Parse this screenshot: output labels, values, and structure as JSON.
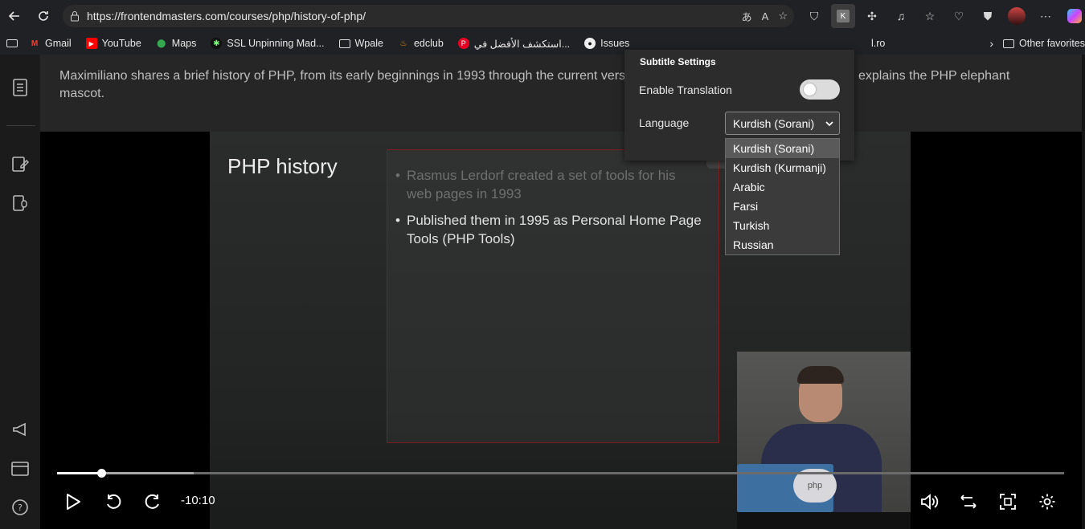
{
  "browser": {
    "url": "https://frontendmasters.com/courses/php/history-of-php/",
    "extensions": [
      {
        "icon": "shield-icon"
      },
      {
        "icon": "k-extension-icon",
        "label": "K"
      },
      {
        "icon": "puzzle-icon"
      },
      {
        "icon": "music-note-icon"
      },
      {
        "icon": "favorites-icon"
      },
      {
        "icon": "heart-pulse-icon"
      },
      {
        "icon": "browser-essentials-icon"
      },
      {
        "icon": "profile-avatar-icon"
      },
      {
        "icon": "more-icon"
      },
      {
        "icon": "copilot-icon"
      }
    ]
  },
  "bookmarks": {
    "items": [
      {
        "label": "",
        "icon": "reading-list-icon"
      },
      {
        "label": "Gmail",
        "icon": "gmail-icon"
      },
      {
        "label": "YouTube",
        "icon": "youtube-icon"
      },
      {
        "label": "Maps",
        "icon": "maps-icon"
      },
      {
        "label": "SSL Unpinning Mad...",
        "icon": "ssl-icon"
      },
      {
        "label": "Wpale",
        "icon": "folder-icon"
      },
      {
        "label": "edclub",
        "icon": "edclub-icon"
      },
      {
        "label": "استكشف الأفضل في...",
        "icon": "pinterest-icon"
      },
      {
        "label": "Issues",
        "icon": "github-icon"
      }
    ],
    "partial": "l.ro",
    "other": "Other favorites"
  },
  "page": {
    "description": "Maximiliano shares a brief history of PHP, from its early beginnings in 1993 through the current vers",
    "description_tail": "esson also explains the PHP elephant",
    "description_line2": "mascot."
  },
  "slide": {
    "title": "PHP history",
    "bullet1": "Rasmus Lerdorf created a set of tools for his web pages in 1993",
    "bullet2": "Published them in 1995 as Personal Home Page Tools (PHP Tools)",
    "elephant_label": "php"
  },
  "player": {
    "time_remaining": "-10:10",
    "progress_fraction": 0.044,
    "buffered_fraction": 0.136
  },
  "subtitle_settings": {
    "title": "Subtitle Settings",
    "enable_translation_label": "Enable Translation",
    "enable_translation": false,
    "language_label": "Language",
    "selected_language": "Kurdish (Sorani)",
    "options": [
      "Kurdish (Sorani)",
      "Kurdish (Kurmanji)",
      "Arabic",
      "Farsi",
      "Turkish",
      "Russian"
    ]
  },
  "colors": {
    "accent": "#7a1f1f",
    "background": "#141414"
  }
}
